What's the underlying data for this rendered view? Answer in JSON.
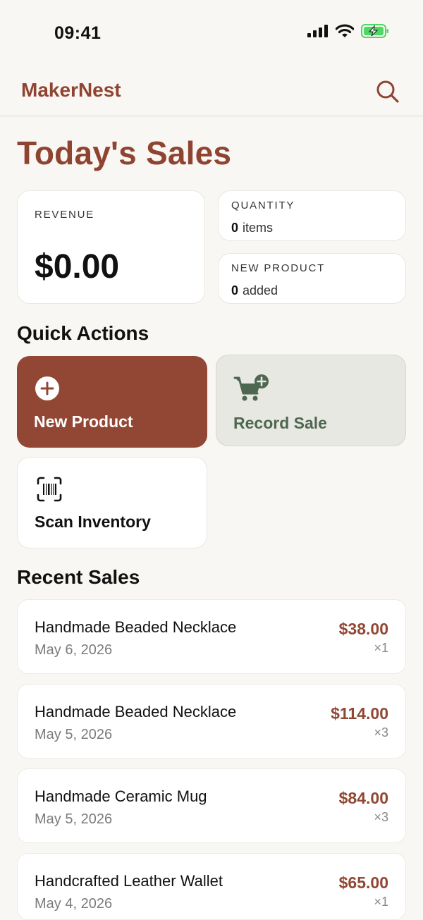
{
  "status_bar": {
    "time": "09:41"
  },
  "header": {
    "brand": "MakerNest"
  },
  "page": {
    "title": "Today's Sales"
  },
  "metrics": {
    "revenue": {
      "label": "REVENUE",
      "value": "$0.00"
    },
    "quantity": {
      "label": "QUANTITY",
      "count": "0",
      "unit": "items"
    },
    "new_product": {
      "label": "NEW PRODUCT",
      "count": "0",
      "unit": "added"
    }
  },
  "quick_actions": {
    "title": "Quick Actions",
    "new_product": "New Product",
    "record_sale": "Record Sale",
    "scan_inventory": "Scan Inventory"
  },
  "recent_sales": {
    "title": "Recent Sales",
    "items": [
      {
        "product": "Handmade Beaded Necklace",
        "date": "May 6, 2026",
        "amount": "$38.00",
        "qty": "×1"
      },
      {
        "product": "Handmade Beaded Necklace",
        "date": "May 5, 2026",
        "amount": "$114.00",
        "qty": "×3"
      },
      {
        "product": "Handmade Ceramic Mug",
        "date": "May 5, 2026",
        "amount": "$84.00",
        "qty": "×3"
      },
      {
        "product": "Handcrafted Leather Wallet",
        "date": "May 4, 2026",
        "amount": "$65.00",
        "qty": "×1"
      }
    ]
  },
  "colors": {
    "accent": "#924634",
    "brand": "#8f4432",
    "secondary": "#4e6751",
    "background": "#f9f7f3",
    "battery": "#4cd964"
  },
  "icons": {
    "signal": "cellular-signal-icon",
    "wifi": "wifi-icon",
    "battery": "battery-charging-icon",
    "search": "search-icon",
    "add": "plus-circle-icon",
    "cart": "cart-plus-icon",
    "scan": "barcode-scan-icon"
  }
}
